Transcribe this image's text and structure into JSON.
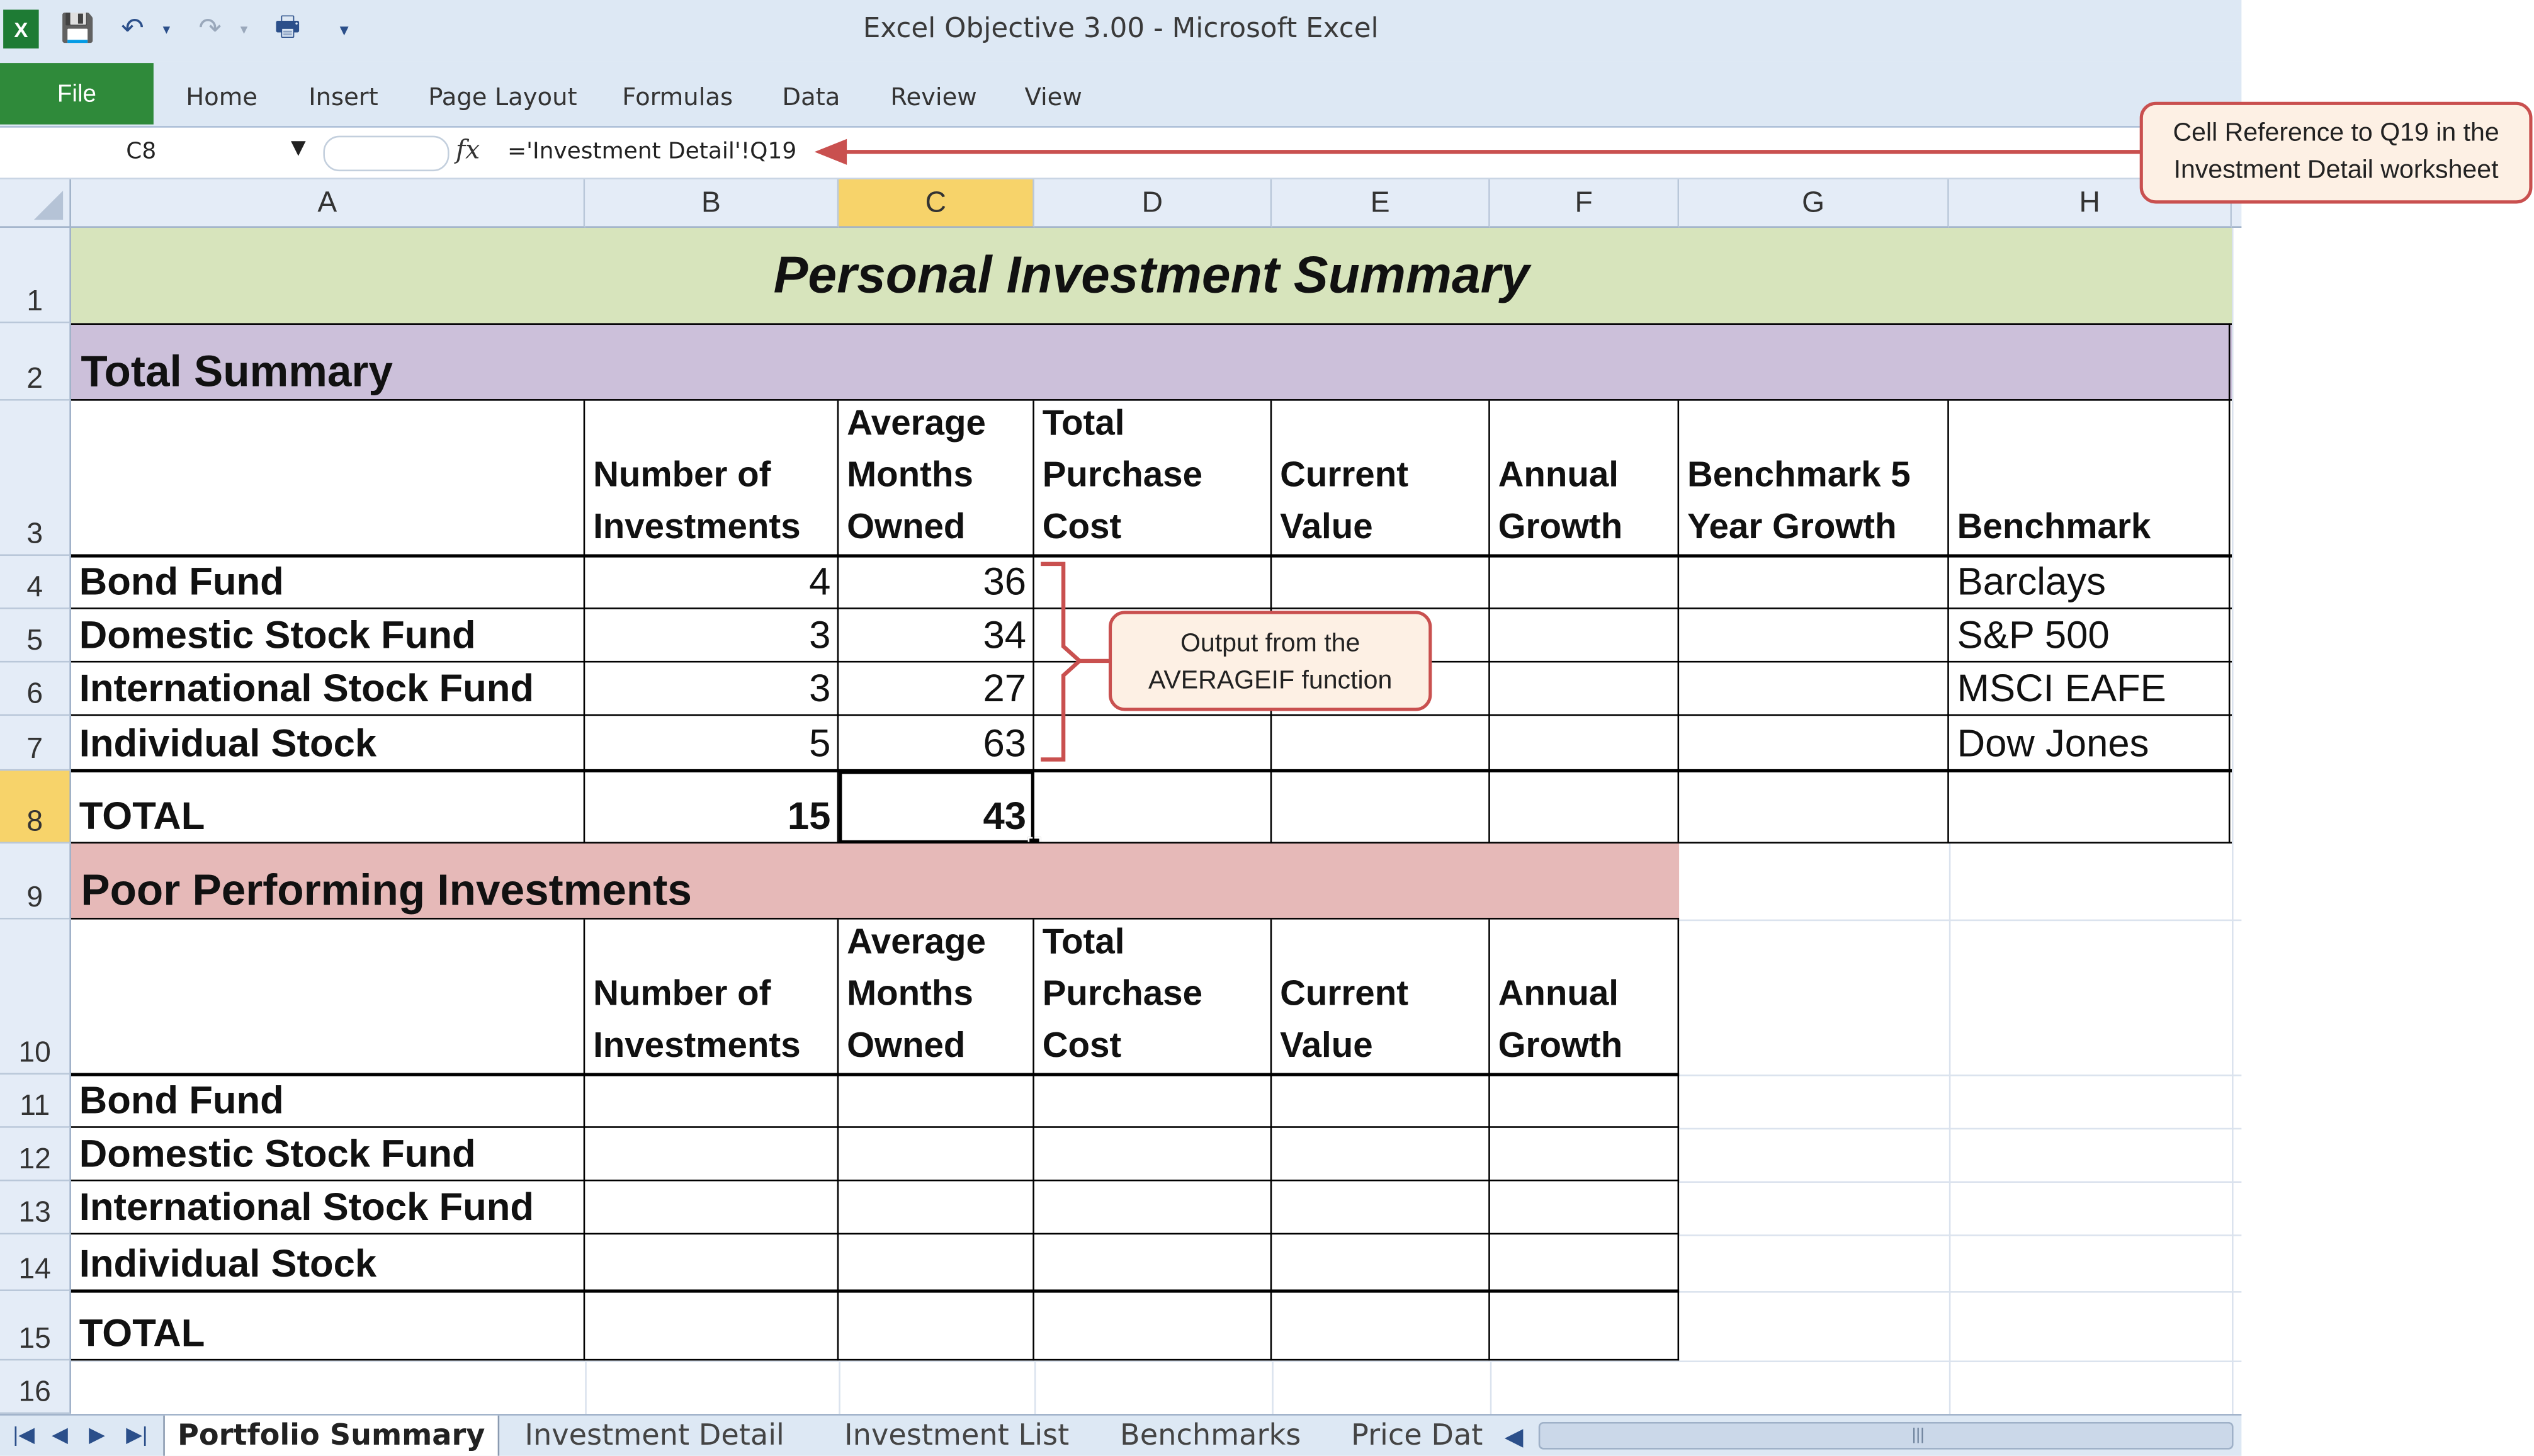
{
  "window": {
    "title": "Excel Objective 3.00  -  Microsoft Excel"
  },
  "ribbon": {
    "file": "File",
    "tabs": [
      "Home",
      "Insert",
      "Page Layout",
      "Formulas",
      "Data",
      "Review",
      "View"
    ]
  },
  "formula_bar": {
    "name_box": "C8",
    "fx": "fx",
    "formula": "='Investment Detail'!Q19"
  },
  "columns": [
    "A",
    "B",
    "C",
    "D",
    "E",
    "F",
    "G",
    "H"
  ],
  "rows": [
    "1",
    "2",
    "3",
    "4",
    "5",
    "6",
    "7",
    "8",
    "9",
    "10",
    "11",
    "12",
    "13",
    "14",
    "15",
    "16"
  ],
  "sheet": {
    "title": "Personal Investment Summary",
    "total_summary": {
      "heading": "Total Summary",
      "headers": [
        "Number of Investments",
        "Average Months Owned",
        "Total Purchase Cost",
        "Current Value",
        "Annual Growth",
        "Benchmark 5 Year Growth",
        "Benchmark"
      ],
      "rows": [
        {
          "label": "Bond Fund",
          "number": "4",
          "months": "36",
          "benchmark": "Barclays"
        },
        {
          "label": "Domestic Stock Fund",
          "number": "3",
          "months": "34",
          "benchmark": "S&P 500"
        },
        {
          "label": "International Stock Fund",
          "number": "3",
          "months": "27",
          "benchmark": "MSCI EAFE"
        },
        {
          "label": "Individual Stock",
          "number": "5",
          "months": "63",
          "benchmark": "Dow Jones"
        }
      ],
      "total": {
        "label": "TOTAL",
        "number": "15",
        "months": "43"
      }
    },
    "poor_performing": {
      "heading": "Poor Performing Investments",
      "headers": [
        "Number of Investments",
        "Average Months Owned",
        "Total Purchase Cost",
        "Current Value",
        "Annual Growth"
      ],
      "rows": [
        "Bond Fund",
        "Domestic Stock Fund",
        "International Stock Fund",
        "Individual Stock"
      ],
      "total": "TOTAL"
    }
  },
  "callouts": {
    "cell_reference": "Cell Reference to Q19 in the Investment Detail worksheet",
    "averageif": "Output from the AVERAGEIF function"
  },
  "sheet_tabs": [
    "Portfolio Summary",
    "Investment Detail",
    "Investment List",
    "Benchmarks",
    "Price Dat"
  ],
  "colors": {
    "title_fill": "#d7e4bc",
    "total_summary_fill": "#ccc0da",
    "poor_performing_fill": "#e6b9b8",
    "callout_border": "#c9504f",
    "file_tab": "#2f8a3a"
  }
}
